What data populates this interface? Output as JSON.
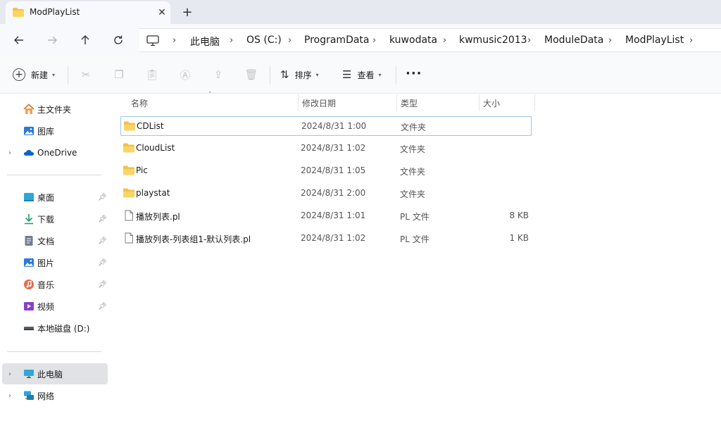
{
  "window": {
    "tab_title": "ModPlayList"
  },
  "address": {
    "crumbs": [
      "此电脑",
      "OS (C:)",
      "ProgramData",
      "kuwodata",
      "kwmusic2013",
      "ModuleData",
      "ModPlayList"
    ]
  },
  "toolbar": {
    "new_label": "新建",
    "sort_label": "排序",
    "view_label": "查看"
  },
  "sidebar": {
    "items": [
      {
        "label": "主文件夹",
        "icon": "home-icon"
      },
      {
        "label": "图库",
        "icon": "gallery-icon"
      },
      {
        "label": "OneDrive",
        "icon": "onedrive-icon"
      },
      {
        "label": "桌面",
        "icon": "desktop-icon"
      },
      {
        "label": "下载",
        "icon": "download-icon"
      },
      {
        "label": "文档",
        "icon": "documents-icon"
      },
      {
        "label": "图片",
        "icon": "pictures-icon"
      },
      {
        "label": "音乐",
        "icon": "music-icon"
      },
      {
        "label": "视频",
        "icon": "videos-icon"
      },
      {
        "label": "本地磁盘 (D:)",
        "icon": "drive-icon"
      },
      {
        "label": "此电脑",
        "icon": "this-pc-icon"
      },
      {
        "label": "网络",
        "icon": "network-icon"
      }
    ]
  },
  "columns": {
    "name": "名称",
    "modified": "修改日期",
    "type": "类型",
    "size": "大小"
  },
  "files": [
    {
      "name": "CDList",
      "modified": "2024/8/31 1:00",
      "type": "文件夹",
      "size": ""
    },
    {
      "name": "CloudList",
      "modified": "2024/8/31 1:02",
      "type": "文件夹",
      "size": ""
    },
    {
      "name": "Pic",
      "modified": "2024/8/31 1:05",
      "type": "文件夹",
      "size": ""
    },
    {
      "name": "playstat",
      "modified": "2024/8/31 2:00",
      "type": "文件夹",
      "size": ""
    },
    {
      "name": "播放列表.pl",
      "modified": "2024/8/31 1:01",
      "type": "PL 文件",
      "size": "8 KB"
    },
    {
      "name": "播放列表-列表组1-默认列表.pl",
      "modified": "2024/8/31 1:02",
      "type": "PL 文件",
      "size": "1 KB"
    }
  ],
  "colors": {
    "folder": "#f4c144",
    "selection_border": "#9cc6ec",
    "accent": "#0a64c8"
  }
}
